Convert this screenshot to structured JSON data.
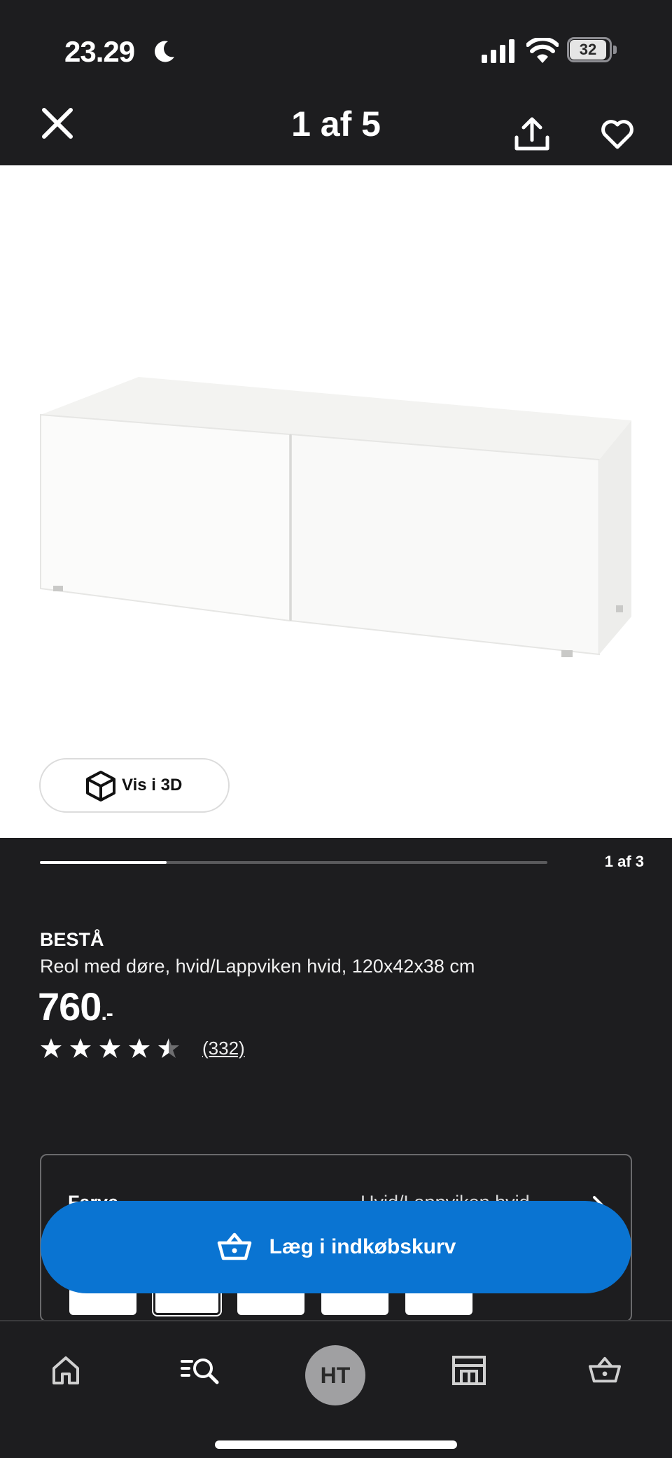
{
  "status_bar": {
    "time": "23.29",
    "battery_level": "32",
    "icons": [
      "moon-icon",
      "signal-icon",
      "wifi-icon",
      "battery-icon"
    ]
  },
  "nav": {
    "page_indicator": "1 af 5",
    "icons": [
      "close-icon",
      "share-icon",
      "heart-icon"
    ]
  },
  "gallery": {
    "view_3d_label": "Vis i 3D",
    "progress_label": "1 af 3",
    "progress_fraction": 0.25
  },
  "product": {
    "brand": "BESTÅ",
    "description": "Reol med døre, hvid/Lappviken hvid, 120x42x38 cm",
    "price": "760",
    "price_suffix": ".-",
    "rating": 4.5,
    "review_count": "(332)"
  },
  "color_selector": {
    "label": "Farve",
    "value": "Hvid/Lappviken hvid"
  },
  "cart": {
    "add_label": "Læg i indkøbskurv"
  },
  "tab_bar": {
    "items": [
      "home-icon",
      "search-icon",
      "profile-avatar",
      "store-icon",
      "basket-icon"
    ],
    "avatar_initials": "HT"
  },
  "colors": {
    "background": "#1d1d1f",
    "accent": "#0a74d2",
    "white": "#ffffff"
  }
}
